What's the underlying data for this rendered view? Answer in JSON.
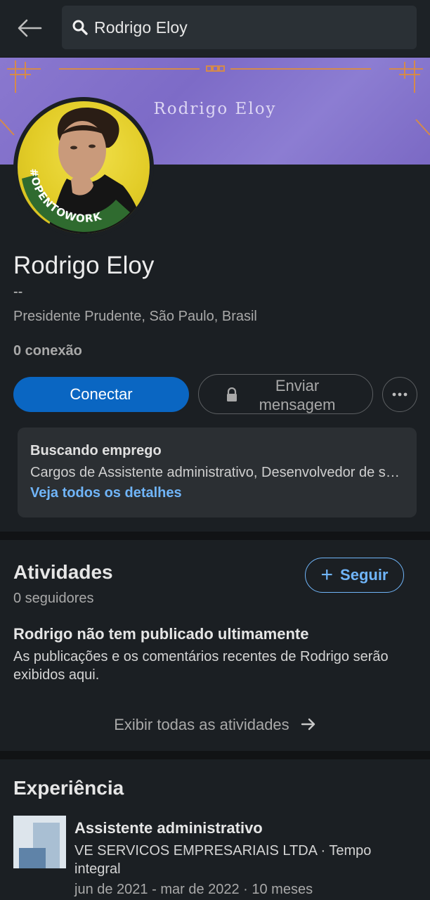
{
  "topbar": {
    "search_value": "Rodrigo Eloy"
  },
  "banner": {
    "text": "Rodrigo Eloy"
  },
  "avatar": {
    "badge": "#OPENTOWORK"
  },
  "profile": {
    "name": "Rodrigo Eloy",
    "headline": "--",
    "location": "Presidente Prudente, São Paulo, Brasil",
    "connections": "0 conexão"
  },
  "actions": {
    "connect": "Conectar",
    "message_line1": "Enviar",
    "message_line2": "mensagem"
  },
  "open_to_work": {
    "title": "Buscando emprego",
    "description": "Cargos de Assistente administrativo, Desenvolvedor de software",
    "link": "Veja todos os detalhes"
  },
  "activities": {
    "title": "Atividades",
    "followers": "0 seguidores",
    "follow": "Seguir",
    "empty_title": "Rodrigo não tem publicado ultimamente",
    "empty_desc": "As publicações e os comentários recentes de Rodrigo serão exibidos aqui.",
    "show_all": "Exibir todas as atividades"
  },
  "experience": {
    "title": "Experiência",
    "items": [
      {
        "role": "Assistente administrativo",
        "company": "VE SERVICOS EMPRESARIAIS LTDA · Tempo integral",
        "dates": "jun de 2021 - mar de 2022 · 10 meses"
      }
    ]
  },
  "colors": {
    "accent": "#0a66c2",
    "link": "#70b5f9",
    "banner": "#8a78cf",
    "otw_green": "#2f6b2f"
  }
}
